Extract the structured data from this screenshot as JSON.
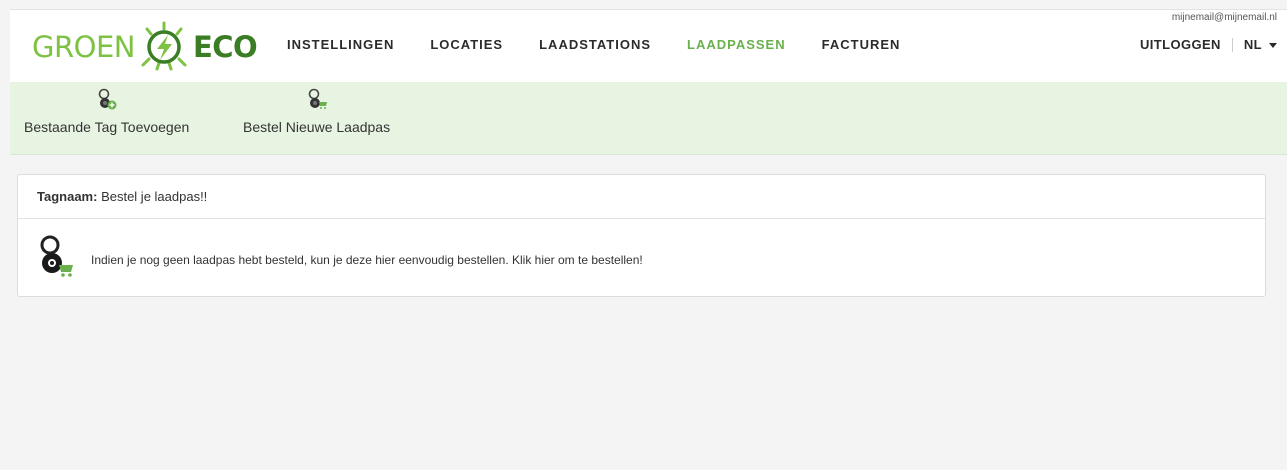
{
  "brand": {
    "name_left": "GROEN",
    "name_right": "ECO",
    "color_primary": "#7dc242",
    "color_dark": "#3a7d24"
  },
  "nav": {
    "items": [
      {
        "label": "INSTELLINGEN",
        "active": false
      },
      {
        "label": "LOCATIES",
        "active": false
      },
      {
        "label": "LAADSTATIONS",
        "active": false
      },
      {
        "label": "LAADPASSEN",
        "active": true
      },
      {
        "label": "FACTUREN",
        "active": false
      }
    ],
    "active_color": "#6ab04c"
  },
  "account": {
    "email": "mijnemail@mijnemail.nl",
    "logout_label": "UITLOGGEN",
    "language": "NL"
  },
  "toolbar": {
    "add_tag": {
      "label": "Bestaande Tag Toevoegen",
      "icon": "tag-add-icon"
    },
    "order_pass": {
      "label": "Bestel Nieuwe Laadpas",
      "icon": "tag-cart-icon"
    }
  },
  "card": {
    "tag_label": "Tagnaam:",
    "tag_value": "Bestel je laadpas!!",
    "message": "Indien je nog geen laadpas hebt besteld, kun je deze hier eenvoudig bestellen. Klik hier om te bestellen!",
    "icon": "tag-cart-icon"
  }
}
